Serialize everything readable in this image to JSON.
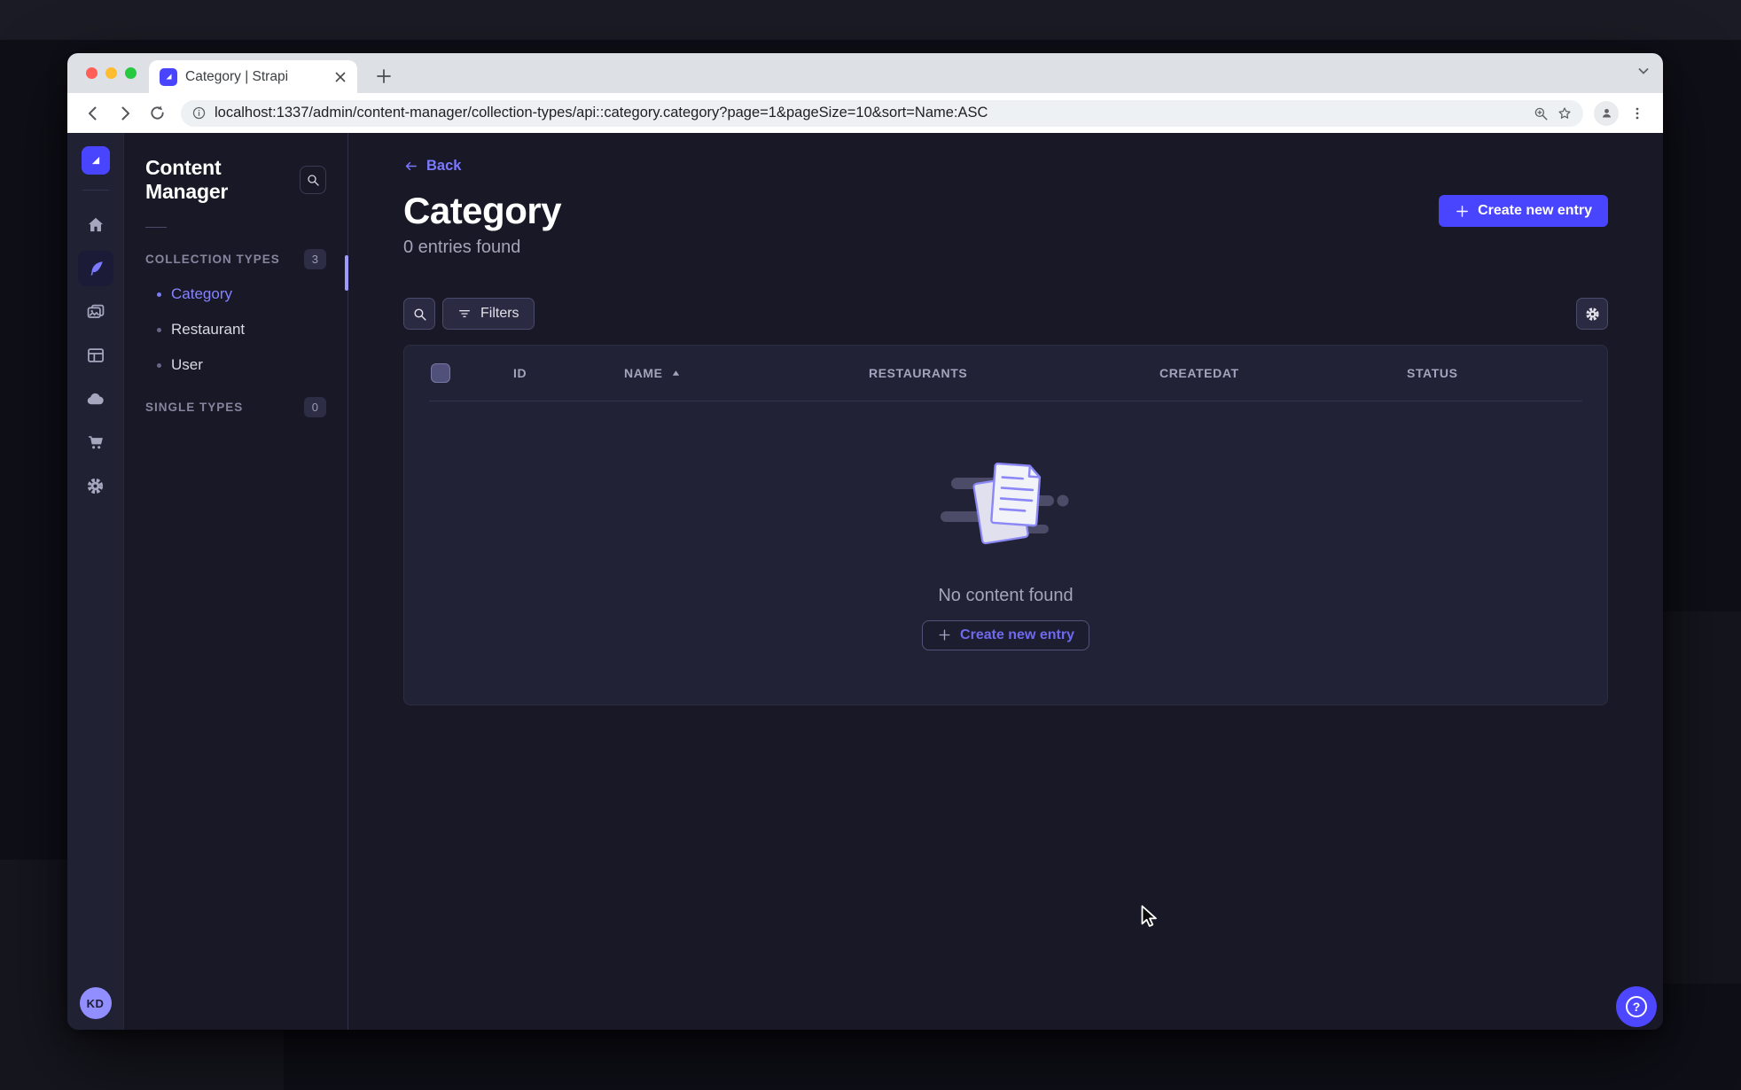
{
  "browser": {
    "tab_title": "Category | Strapi",
    "url": "localhost:1337/admin/content-manager/collection-types/api::category.category?page=1&pageSize=10&sort=Name:ASC"
  },
  "nav": {
    "logo_icon": "strapi-logo",
    "items": [
      {
        "icon": "home-icon"
      },
      {
        "icon": "content-manager-icon",
        "active": true
      },
      {
        "icon": "media-library-icon"
      },
      {
        "icon": "content-type-builder-icon"
      },
      {
        "icon": "cloud-icon"
      },
      {
        "icon": "marketplace-icon"
      },
      {
        "icon": "settings-icon"
      }
    ],
    "user_initials": "KD"
  },
  "subnav": {
    "title": "Content Manager",
    "search_icon": "search-icon",
    "sections": [
      {
        "label": "COLLECTION TYPES",
        "count": "3"
      },
      {
        "label": "SINGLE TYPES",
        "count": "0"
      }
    ],
    "collection_types": [
      {
        "label": "Category",
        "active": true
      },
      {
        "label": "Restaurant",
        "active": false
      },
      {
        "label": "User",
        "active": false
      }
    ]
  },
  "page": {
    "back_label": "Back",
    "title": "Category",
    "subtitle": "0 entries found",
    "create_button": "Create new entry"
  },
  "filter_bar": {
    "search_icon": "search-icon",
    "filters_label": "Filters",
    "settings_icon": "gear-icon"
  },
  "table": {
    "columns": [
      "ID",
      "NAME",
      "RESTAURANTS",
      "CREATEDAT",
      "STATUS"
    ],
    "sort_column": "NAME",
    "sort_direction": "asc",
    "empty_message": "No content found",
    "empty_cta": "Create new entry"
  },
  "help": {
    "label": "?"
  },
  "colors": {
    "brand": "#4945ff",
    "brand_light": "#7b79ff",
    "page_bg": "#181826",
    "surface": "#222236",
    "nav_bg": "#212134",
    "text_muted": "#a5a5ba"
  }
}
